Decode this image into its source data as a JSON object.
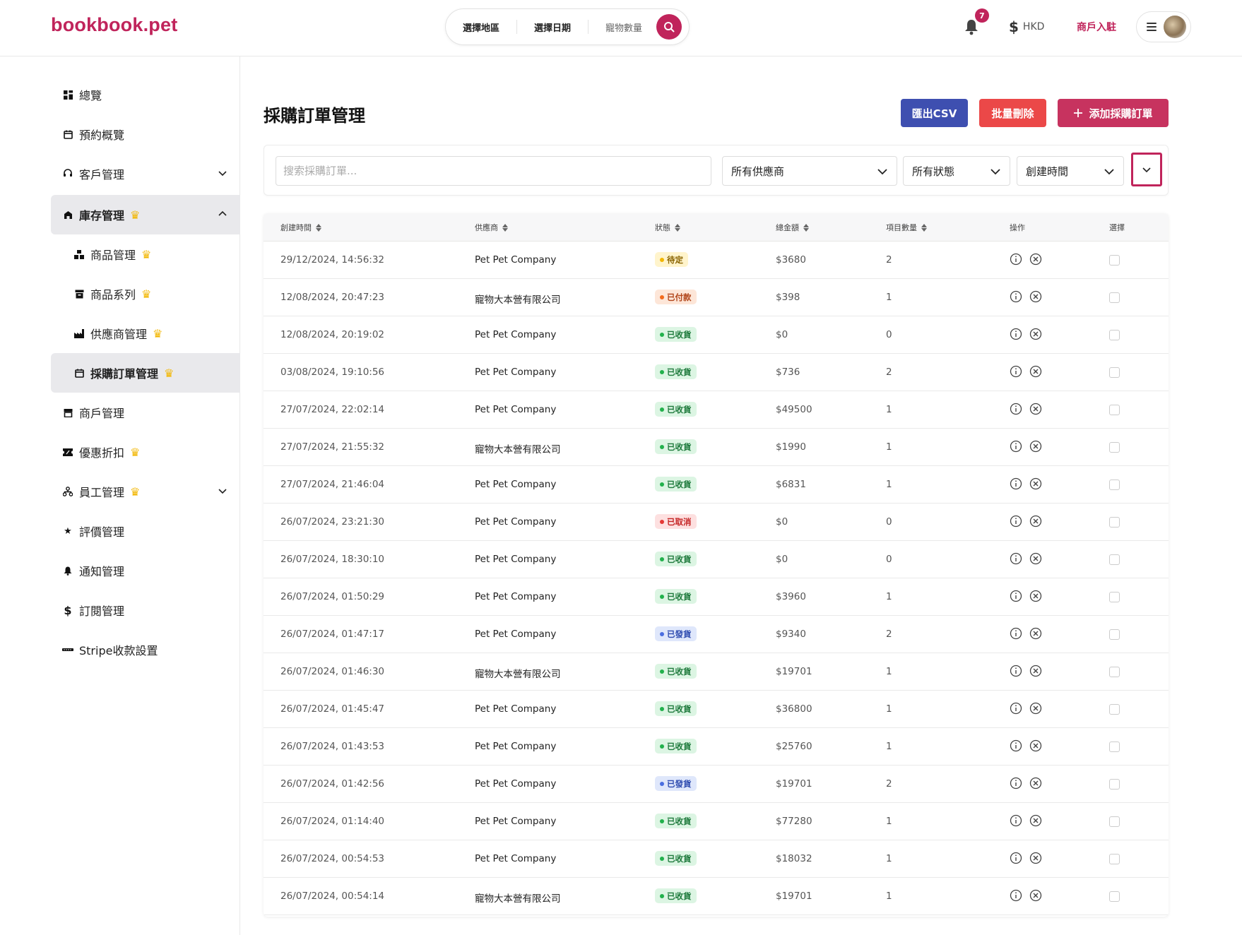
{
  "header": {
    "logo": "bookbook.pet",
    "search": {
      "region": "選擇地區",
      "date": "選擇日期",
      "pets": "寵物數量"
    },
    "notifications_count": "7",
    "currency": "HKD",
    "merchant_link": "商戶入駐"
  },
  "sidebar": {
    "items": [
      {
        "label": "總覽",
        "icon": "dashboard-icon"
      },
      {
        "label": "預約概覽",
        "icon": "calendar-icon"
      },
      {
        "label": "客戶管理",
        "icon": "headset-icon"
      },
      {
        "label": "庫存管理",
        "icon": "store-icon"
      },
      {
        "label": "商品管理",
        "icon": "boxes-icon"
      },
      {
        "label": "商品系列",
        "icon": "archive-icon"
      },
      {
        "label": "供應商管理",
        "icon": "factory-icon"
      },
      {
        "label": "採購訂單管理",
        "icon": "calendar-icon"
      },
      {
        "label": "商戶管理",
        "icon": "shop-icon"
      },
      {
        "label": "優惠折扣",
        "icon": "ticket-icon"
      },
      {
        "label": "員工管理",
        "icon": "org-icon"
      },
      {
        "label": "評價管理",
        "icon": "star-icon"
      },
      {
        "label": "通知管理",
        "icon": "bell-icon"
      },
      {
        "label": "訂閱管理",
        "icon": "dollar-icon"
      },
      {
        "label": "Stripe收款設置",
        "icon": "stripe-icon"
      }
    ]
  },
  "main": {
    "title": "採購訂單管理",
    "buttons": {
      "export": "匯出CSV",
      "bulk_delete": "批量刪除",
      "add": "添加採購訂單"
    },
    "filters": {
      "search_placeholder": "搜索採購訂單...",
      "supplier": "所有供應商",
      "status": "所有狀態",
      "sort": "創建時間"
    },
    "table": {
      "headers": {
        "date": "創建時間",
        "supplier": "供應商",
        "status": "狀態",
        "amount": "總金額",
        "count": "項目數量",
        "ops": "操作",
        "select": "選擇"
      },
      "rows": [
        {
          "date": "29/12/2024, 14:56:32",
          "supplier": "Pet Pet Company",
          "status": "待定",
          "status_type": "pending",
          "amount": "$3680",
          "count": "2"
        },
        {
          "date": "12/08/2024, 20:47:23",
          "supplier": "寵物大本營有限公司",
          "status": "已付款",
          "status_type": "paid",
          "amount": "$398",
          "count": "1"
        },
        {
          "date": "12/08/2024, 20:19:02",
          "supplier": "Pet Pet Company",
          "status": "已收貨",
          "status_type": "received",
          "amount": "$0",
          "count": "0"
        },
        {
          "date": "03/08/2024, 19:10:56",
          "supplier": "Pet Pet Company",
          "status": "已收貨",
          "status_type": "received",
          "amount": "$736",
          "count": "2"
        },
        {
          "date": "27/07/2024, 22:02:14",
          "supplier": "Pet Pet Company",
          "status": "已收貨",
          "status_type": "received",
          "amount": "$49500",
          "count": "1"
        },
        {
          "date": "27/07/2024, 21:55:32",
          "supplier": "寵物大本營有限公司",
          "status": "已收貨",
          "status_type": "received",
          "amount": "$1990",
          "count": "1"
        },
        {
          "date": "27/07/2024, 21:46:04",
          "supplier": "Pet Pet Company",
          "status": "已收貨",
          "status_type": "received",
          "amount": "$6831",
          "count": "1"
        },
        {
          "date": "26/07/2024, 23:21:30",
          "supplier": "Pet Pet Company",
          "status": "已取消",
          "status_type": "cancel",
          "amount": "$0",
          "count": "0"
        },
        {
          "date": "26/07/2024, 18:30:10",
          "supplier": "Pet Pet Company",
          "status": "已收貨",
          "status_type": "received",
          "amount": "$0",
          "count": "0"
        },
        {
          "date": "26/07/2024, 01:50:29",
          "supplier": "Pet Pet Company",
          "status": "已收貨",
          "status_type": "received",
          "amount": "$3960",
          "count": "1"
        },
        {
          "date": "26/07/2024, 01:47:17",
          "supplier": "Pet Pet Company",
          "status": "已發貨",
          "status_type": "shipped",
          "amount": "$9340",
          "count": "2"
        },
        {
          "date": "26/07/2024, 01:46:30",
          "supplier": "寵物大本營有限公司",
          "status": "已收貨",
          "status_type": "received",
          "amount": "$19701",
          "count": "1"
        },
        {
          "date": "26/07/2024, 01:45:47",
          "supplier": "Pet Pet Company",
          "status": "已收貨",
          "status_type": "received",
          "amount": "$36800",
          "count": "1"
        },
        {
          "date": "26/07/2024, 01:43:53",
          "supplier": "Pet Pet Company",
          "status": "已收貨",
          "status_type": "received",
          "amount": "$25760",
          "count": "1"
        },
        {
          "date": "26/07/2024, 01:42:56",
          "supplier": "Pet Pet Company",
          "status": "已發貨",
          "status_type": "shipped",
          "amount": "$19701",
          "count": "2"
        },
        {
          "date": "26/07/2024, 01:14:40",
          "supplier": "Pet Pet Company",
          "status": "已收貨",
          "status_type": "received",
          "amount": "$77280",
          "count": "1"
        },
        {
          "date": "26/07/2024, 00:54:53",
          "supplier": "Pet Pet Company",
          "status": "已收貨",
          "status_type": "received",
          "amount": "$18032",
          "count": "1"
        },
        {
          "date": "26/07/2024, 00:54:14",
          "supplier": "寵物大本營有限公司",
          "status": "已收貨",
          "status_type": "received",
          "amount": "$19701",
          "count": "1"
        }
      ]
    }
  },
  "colors": {
    "brand": "#c0245b",
    "export": "#3e4fb0",
    "delete": "#eb4848",
    "add": "#c7335f"
  }
}
